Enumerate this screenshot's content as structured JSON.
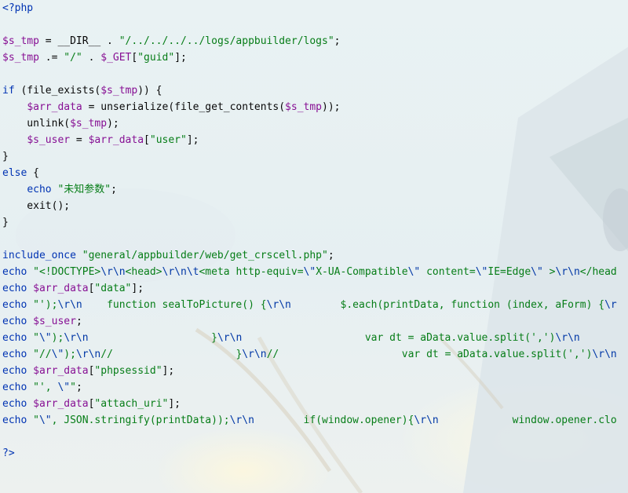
{
  "editor": {
    "language": "php",
    "colors": {
      "keyword": "#0033b3",
      "variable": "#871094",
      "string": "#067d17",
      "default": "#080808"
    },
    "lines": [
      [
        {
          "t": "<?php",
          "c": "tag"
        }
      ],
      [],
      [
        {
          "t": "$s_tmp",
          "c": "var"
        },
        {
          "t": " = __DIR__ . ",
          "c": "fn"
        },
        {
          "t": "\"/../../../../logs/appbuilder/logs\"",
          "c": "str"
        },
        {
          "t": ";",
          "c": "fn"
        }
      ],
      [
        {
          "t": "$s_tmp",
          "c": "var"
        },
        {
          "t": " .= ",
          "c": "fn"
        },
        {
          "t": "\"/\"",
          "c": "str"
        },
        {
          "t": " . ",
          "c": "fn"
        },
        {
          "t": "$_GET",
          "c": "var"
        },
        {
          "t": "[",
          "c": "fn"
        },
        {
          "t": "\"guid\"",
          "c": "str"
        },
        {
          "t": "];",
          "c": "fn"
        }
      ],
      [],
      [
        {
          "t": "if",
          "c": "kw"
        },
        {
          "t": " (file_exists(",
          "c": "fn"
        },
        {
          "t": "$s_tmp",
          "c": "var"
        },
        {
          "t": ")) {",
          "c": "fn"
        }
      ],
      [
        {
          "t": "    ",
          "c": "fn"
        },
        {
          "t": "$arr_data",
          "c": "var"
        },
        {
          "t": " = unserialize(file_get_contents(",
          "c": "fn"
        },
        {
          "t": "$s_tmp",
          "c": "var"
        },
        {
          "t": "));",
          "c": "fn"
        }
      ],
      [
        {
          "t": "    unlink(",
          "c": "fn"
        },
        {
          "t": "$s_tmp",
          "c": "var"
        },
        {
          "t": ");",
          "c": "fn"
        }
      ],
      [
        {
          "t": "    ",
          "c": "fn"
        },
        {
          "t": "$s_user",
          "c": "var"
        },
        {
          "t": " = ",
          "c": "fn"
        },
        {
          "t": "$arr_data",
          "c": "var"
        },
        {
          "t": "[",
          "c": "fn"
        },
        {
          "t": "\"user\"",
          "c": "str"
        },
        {
          "t": "];",
          "c": "fn"
        }
      ],
      [
        {
          "t": "}",
          "c": "fn"
        }
      ],
      [
        {
          "t": "else",
          "c": "kw"
        },
        {
          "t": " {",
          "c": "fn"
        }
      ],
      [
        {
          "t": "    ",
          "c": "fn"
        },
        {
          "t": "echo",
          "c": "kw"
        },
        {
          "t": " ",
          "c": "fn"
        },
        {
          "t": "\"未知参数\"",
          "c": "str"
        },
        {
          "t": ";",
          "c": "fn"
        }
      ],
      [
        {
          "t": "    exit();",
          "c": "fn"
        }
      ],
      [
        {
          "t": "}",
          "c": "fn"
        }
      ],
      [],
      [
        {
          "t": "include_once",
          "c": "kw"
        },
        {
          "t": " ",
          "c": "fn"
        },
        {
          "t": "\"general/appbuilder/web/get_crscell.php\"",
          "c": "str"
        },
        {
          "t": ";",
          "c": "fn"
        }
      ],
      [
        {
          "t": "echo",
          "c": "kw"
        },
        {
          "t": " ",
          "c": "fn"
        },
        {
          "t": "\"<!DOCTYPE>",
          "c": "str"
        },
        {
          "t": "\\r\\n",
          "c": "esc"
        },
        {
          "t": "<head>",
          "c": "str"
        },
        {
          "t": "\\r\\n\\t",
          "c": "esc"
        },
        {
          "t": "<meta http-equiv=",
          "c": "str"
        },
        {
          "t": "\\\"",
          "c": "esc"
        },
        {
          "t": "X-UA-Compatible",
          "c": "str"
        },
        {
          "t": "\\\"",
          "c": "esc"
        },
        {
          "t": " content=",
          "c": "str"
        },
        {
          "t": "\\\"",
          "c": "esc"
        },
        {
          "t": "IE=Edge",
          "c": "str"
        },
        {
          "t": "\\\"",
          "c": "esc"
        },
        {
          "t": " >",
          "c": "str"
        },
        {
          "t": "\\r\\n",
          "c": "esc"
        },
        {
          "t": "</head",
          "c": "str"
        }
      ],
      [
        {
          "t": "echo",
          "c": "kw"
        },
        {
          "t": " ",
          "c": "fn"
        },
        {
          "t": "$arr_data",
          "c": "var"
        },
        {
          "t": "[",
          "c": "fn"
        },
        {
          "t": "\"data\"",
          "c": "str"
        },
        {
          "t": "];",
          "c": "fn"
        }
      ],
      [
        {
          "t": "echo",
          "c": "kw"
        },
        {
          "t": " ",
          "c": "fn"
        },
        {
          "t": "\"');",
          "c": "str"
        },
        {
          "t": "\\r\\n",
          "c": "esc"
        },
        {
          "t": "    function sealToPicture() {",
          "c": "str"
        },
        {
          "t": "\\r\\n",
          "c": "esc"
        },
        {
          "t": "        $.each(printData, function (index, aForm) {",
          "c": "str"
        },
        {
          "t": "\\r",
          "c": "esc"
        }
      ],
      [
        {
          "t": "echo",
          "c": "kw"
        },
        {
          "t": " ",
          "c": "fn"
        },
        {
          "t": "$s_user",
          "c": "var"
        },
        {
          "t": ";",
          "c": "fn"
        }
      ],
      [
        {
          "t": "echo",
          "c": "kw"
        },
        {
          "t": " ",
          "c": "fn"
        },
        {
          "t": "\"",
          "c": "str"
        },
        {
          "t": "\\\"",
          "c": "esc"
        },
        {
          "t": ");",
          "c": "str"
        },
        {
          "t": "\\r\\n",
          "c": "esc"
        },
        {
          "t": "                    }",
          "c": "str"
        },
        {
          "t": "\\r\\n",
          "c": "esc"
        },
        {
          "t": "                    var dt = aData.value.split(',')",
          "c": "str"
        },
        {
          "t": "\\r\\n",
          "c": "esc"
        }
      ],
      [
        {
          "t": "echo",
          "c": "kw"
        },
        {
          "t": " ",
          "c": "fn"
        },
        {
          "t": "\"//",
          "c": "str"
        },
        {
          "t": "\\\"",
          "c": "esc"
        },
        {
          "t": ");",
          "c": "str"
        },
        {
          "t": "\\r\\n",
          "c": "esc"
        },
        {
          "t": "//",
          "c": "str"
        },
        {
          "t": "                    }",
          "c": "str"
        },
        {
          "t": "\\r\\n",
          "c": "esc"
        },
        {
          "t": "//",
          "c": "str"
        },
        {
          "t": "                    var dt = aData.value.split(',')",
          "c": "str"
        },
        {
          "t": "\\r\\n",
          "c": "esc"
        }
      ],
      [
        {
          "t": "echo",
          "c": "kw"
        },
        {
          "t": " ",
          "c": "fn"
        },
        {
          "t": "$arr_data",
          "c": "var"
        },
        {
          "t": "[",
          "c": "fn"
        },
        {
          "t": "\"phpsessid\"",
          "c": "str"
        },
        {
          "t": "];",
          "c": "fn"
        }
      ],
      [
        {
          "t": "echo",
          "c": "kw"
        },
        {
          "t": " ",
          "c": "fn"
        },
        {
          "t": "\"', ",
          "c": "str"
        },
        {
          "t": "\\\"",
          "c": "esc"
        },
        {
          "t": "\"",
          "c": "str"
        },
        {
          "t": ";",
          "c": "fn"
        }
      ],
      [
        {
          "t": "echo",
          "c": "kw"
        },
        {
          "t": " ",
          "c": "fn"
        },
        {
          "t": "$arr_data",
          "c": "var"
        },
        {
          "t": "[",
          "c": "fn"
        },
        {
          "t": "\"attach_uri\"",
          "c": "str"
        },
        {
          "t": "];",
          "c": "fn"
        }
      ],
      [
        {
          "t": "echo",
          "c": "kw"
        },
        {
          "t": " ",
          "c": "fn"
        },
        {
          "t": "\"",
          "c": "str"
        },
        {
          "t": "\\\"",
          "c": "esc"
        },
        {
          "t": ", JSON.stringify(printData));",
          "c": "str"
        },
        {
          "t": "\\r\\n",
          "c": "esc"
        },
        {
          "t": "        if(window.opener){",
          "c": "str"
        },
        {
          "t": "\\r\\n",
          "c": "esc"
        },
        {
          "t": "            window.opener.clo",
          "c": "str"
        }
      ],
      [],
      [
        {
          "t": "?>",
          "c": "tag"
        }
      ]
    ]
  }
}
